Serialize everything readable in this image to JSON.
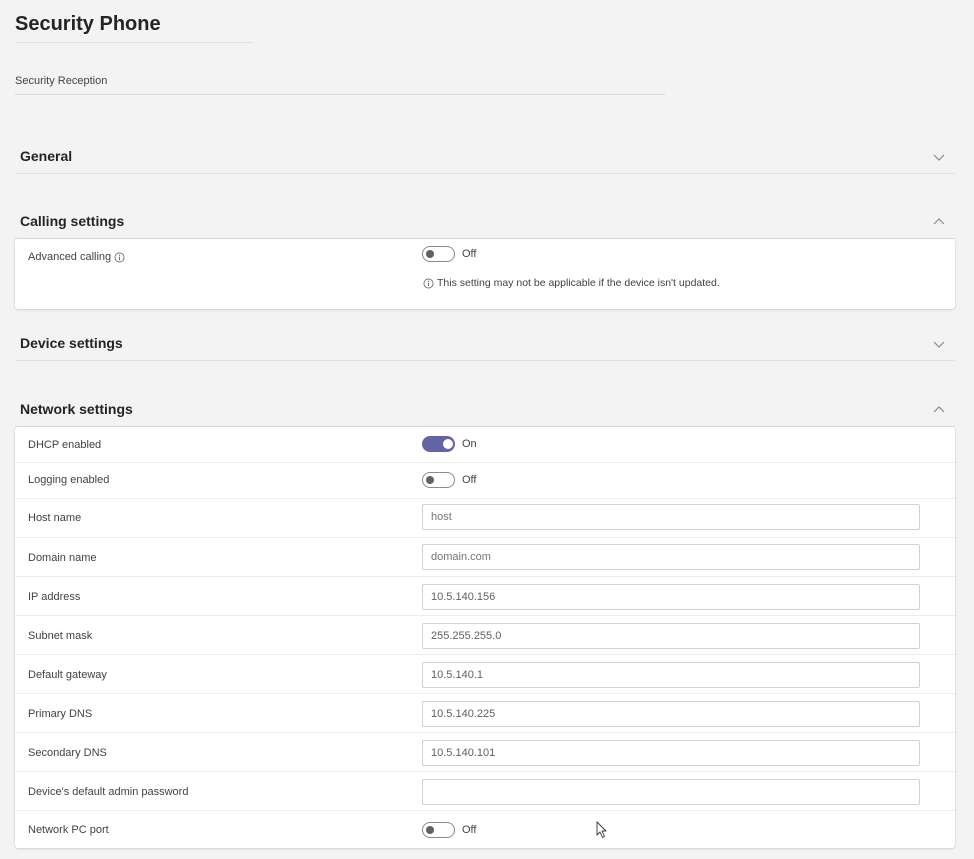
{
  "page": {
    "title": "Security Phone",
    "description": "Security Reception"
  },
  "sections": {
    "general": {
      "title": "General",
      "expanded": false
    },
    "calling": {
      "title": "Calling settings",
      "expanded": true,
      "advanced_calling": {
        "label": "Advanced calling",
        "state": "Off",
        "on": false,
        "note": "This setting may not be applicable if the device isn't updated."
      }
    },
    "device": {
      "title": "Device settings",
      "expanded": false
    },
    "network": {
      "title": "Network settings",
      "expanded": true,
      "dhcp": {
        "label": "DHCP enabled",
        "state": "On",
        "on": true
      },
      "logging": {
        "label": "Logging enabled",
        "state": "Off",
        "on": false
      },
      "host_name": {
        "label": "Host name",
        "placeholder": "host",
        "value": ""
      },
      "domain_name": {
        "label": "Domain name",
        "placeholder": "domain.com",
        "value": ""
      },
      "ip_address": {
        "label": "IP address",
        "value": "10.5.140.156"
      },
      "subnet_mask": {
        "label": "Subnet mask",
        "value": "255.255.255.0"
      },
      "default_gateway": {
        "label": "Default gateway",
        "value": "10.5.140.1"
      },
      "primary_dns": {
        "label": "Primary DNS",
        "value": "10.5.140.225"
      },
      "secondary_dns": {
        "label": "Secondary DNS",
        "value": "10.5.140.101"
      },
      "admin_password": {
        "label": "Device's default admin password",
        "value": ""
      },
      "pc_port": {
        "label": "Network PC port",
        "state": "Off",
        "on": false
      }
    }
  },
  "colors": {
    "accent": "#6264a7",
    "background": "#f3f3f3",
    "panel": "#ffffff"
  },
  "icons": {
    "collapsed": "chevron-down-icon",
    "expanded": "chevron-up-icon",
    "info": "info-icon"
  }
}
